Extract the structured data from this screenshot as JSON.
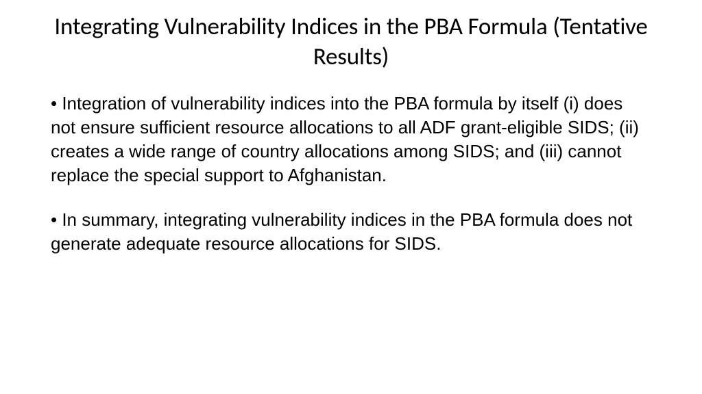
{
  "slide": {
    "title": "Integrating Vulnerability Indices in the PBA Formula (Tentative Results)",
    "bullets": [
      "• Integration of vulnerability indices into the PBA formula by itself (i) does not ensure sufficient resource allocations to all ADF grant-eligible SIDS; (ii) creates a wide range of country allocations among SIDS; and (iii) cannot replace the special support to Afghanistan.",
      "• In summary, integrating vulnerability indices in the PBA formula does not generate adequate resource allocations for SIDS."
    ]
  }
}
